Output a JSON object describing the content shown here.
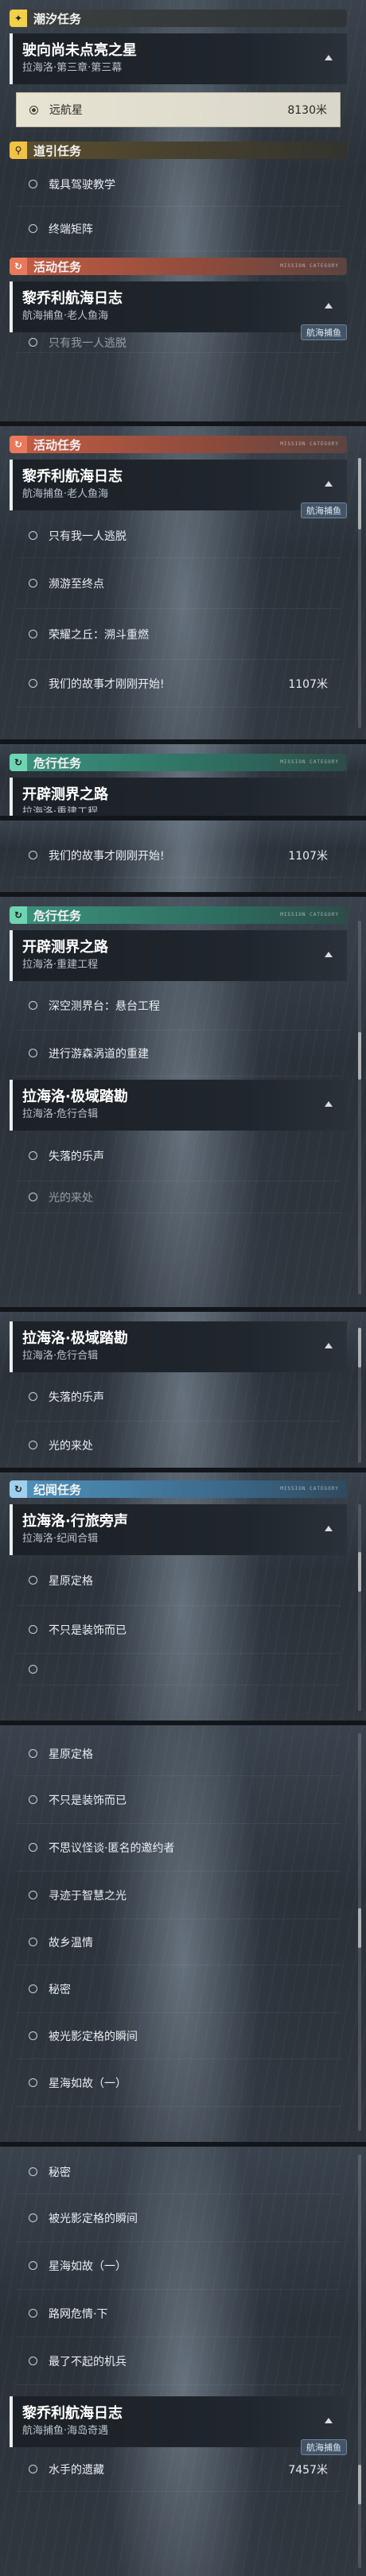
{
  "categories": {
    "tide": "潮汐任务",
    "guide": "道引任务",
    "activity": "活动任务",
    "danger": "危行任务",
    "record": "纪闻任务"
  },
  "header_tag": "MISSION CATEGORY",
  "badge_label": "航海捕鱼",
  "tide_mission": {
    "title": "驶向尚未点亮之星",
    "subtitle": "拉海洛·第三章·第三幕",
    "objective": "远航星",
    "distance": "8130米"
  },
  "guide_objectives": [
    "载具驾驶教学",
    "终端矩阵"
  ],
  "voyage_log_old": {
    "title": "黎乔利航海日志",
    "subtitle": "航海捕鱼·老人鱼海"
  },
  "voyage_objectives": [
    "只有我一人逃脱",
    "濒游至终点",
    "荣耀之丘：溯斗重燃",
    "我们的故事才刚刚开始!"
  ],
  "voyage_distance": "1107米",
  "pioneer": {
    "title": "开辟测界之路",
    "subtitle": "拉海洛·重建工程",
    "objectives": [
      "深空测界台：悬台工程",
      "进行游森涡道的重建"
    ]
  },
  "extreme": {
    "title": "拉海洛·极域踏勘",
    "subtitle": "拉海洛·危行合辑",
    "objectives": [
      "失落的乐声",
      "光的来处"
    ]
  },
  "wander": {
    "title": "拉海洛·行旅旁声",
    "subtitle": "拉海洛·纪闻合辑",
    "objectives": [
      "星原定格",
      "不只是装饰而已",
      "不思议怪谈·匿名的邀约者",
      "寻迹于智慧之光",
      "故乡温情",
      "秘密",
      "被光影定格的瞬间",
      "星海如故（一）",
      "路网危情·下",
      "最了不起的机兵"
    ]
  },
  "voyage_log_new": {
    "title": "黎乔利航海日志",
    "subtitle": "航海捕鱼·海岛奇遇",
    "objective": "水手的遗藏",
    "distance": "7457米"
  },
  "partial_text": "只有我一人逃脱"
}
